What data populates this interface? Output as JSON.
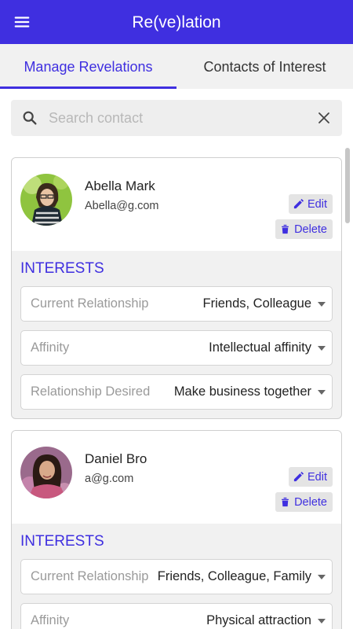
{
  "app": {
    "title": "Re(ve)lation"
  },
  "tabs": [
    {
      "label": "Manage Revelations",
      "active": true
    },
    {
      "label": "Contacts of Interest",
      "active": false
    }
  ],
  "search": {
    "placeholder": "Search contact",
    "value": ""
  },
  "colors": {
    "primary": "#3f2fe0",
    "tab_bar": "#f1f1f1",
    "card_body": "#f1f1f1"
  },
  "contacts": [
    {
      "name": "Abella Mark",
      "email": "Abella@g.com",
      "edit_label": "Edit",
      "delete_label": "Delete",
      "interests_title": "INTERESTS",
      "fields": [
        {
          "label": "Current Relationship",
          "value": "Friends, Colleague"
        },
        {
          "label": "Affinity",
          "value": "Intellectual affinity"
        },
        {
          "label": "Relationship Desired",
          "value": "Make business together"
        }
      ]
    },
    {
      "name": "Daniel Bro",
      "email": "a@g.com",
      "edit_label": "Edit",
      "delete_label": "Delete",
      "interests_title": "INTERESTS",
      "fields": [
        {
          "label": "Current Relationship",
          "value": "Friends, Colleague, Family"
        },
        {
          "label": "Affinity",
          "value": "Physical attraction"
        }
      ]
    }
  ]
}
